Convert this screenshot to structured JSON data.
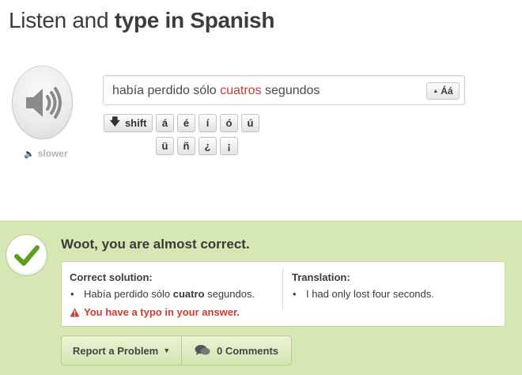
{
  "header": {
    "title_plain": "Listen and ",
    "title_bold": "type in Spanish"
  },
  "audio": {
    "play_icon": "speaker-icon",
    "slower_label": "slower"
  },
  "answer": {
    "before": "había perdido sólo ",
    "typo": "cuatros",
    "after": " segundos",
    "case_toggle_label": "Áá"
  },
  "keyboard": {
    "shift_label": "shift",
    "row1": [
      "á",
      "é",
      "í",
      "ó",
      "ú"
    ],
    "row2": [
      "ü",
      "ñ",
      "¿",
      "¡"
    ]
  },
  "feedback": {
    "title": "Woot, you are almost correct.",
    "correct_heading": "Correct solution:",
    "correct_before": "Había perdido sólo ",
    "correct_bold": "cuatro",
    "correct_after": " segundos.",
    "translation_heading": "Translation:",
    "translation_text": "I had only lost four seconds.",
    "typo_message": "You have a typo in your answer."
  },
  "actions": {
    "report_label": "Report a Problem",
    "comments_label": "0 Comments"
  },
  "colors": {
    "feedback_bg": "#d6e7b4",
    "check": "#5aa21a",
    "error": "#d23b32"
  }
}
